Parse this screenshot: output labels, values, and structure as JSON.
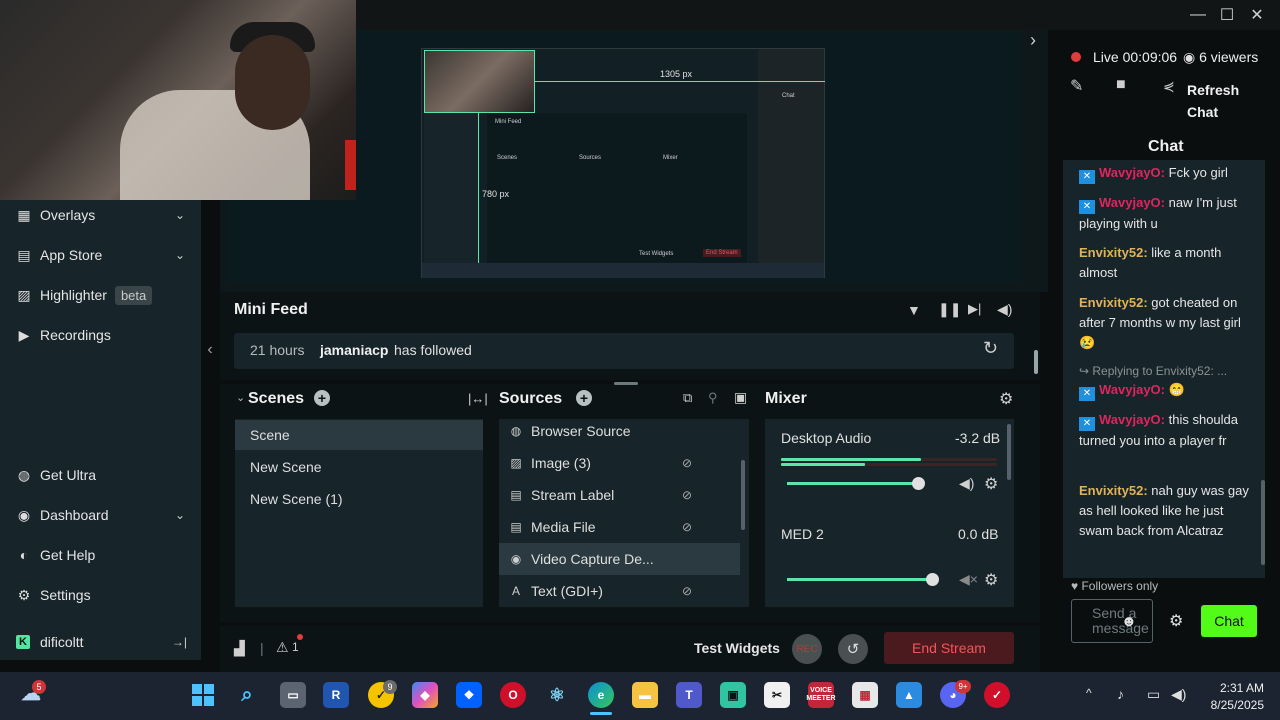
{
  "window": {
    "minimize": "—",
    "maximize": "☐",
    "close": "✕",
    "expand_arrow": "›"
  },
  "sidebar": {
    "items": [
      {
        "label": "Overlays",
        "icon": "overlays-icon",
        "chevron": "⌄"
      },
      {
        "label": "App Store",
        "icon": "store-icon",
        "chevron": "⌄"
      },
      {
        "label": "Highlighter",
        "badge": "beta",
        "icon": "highlighter-icon"
      },
      {
        "label": "Recordings",
        "icon": "play-icon"
      }
    ],
    "bottom": [
      {
        "label": "Get Ultra",
        "icon": "ultra-icon"
      },
      {
        "label": "Dashboard",
        "icon": "dashboard-icon",
        "chevron": "⌄"
      },
      {
        "label": "Get Help",
        "icon": "help-icon"
      },
      {
        "label": "Settings",
        "icon": "gear-icon"
      }
    ],
    "user": "dificoltt",
    "logout": "→|",
    "collapse": "‹"
  },
  "preview": {
    "width_label": "1305 px",
    "height_label": "780 px",
    "inner_feed_title": "Mini Feed",
    "inner_scenes": "Scenes",
    "inner_sources": "Sources",
    "inner_mixer": "Mixer",
    "inner_chat": "Chat",
    "inner_end": "End Stream",
    "inner_test": "Test Widgets"
  },
  "minifeed": {
    "title": "Mini Feed",
    "event": {
      "time": "21 hours",
      "user": "jamaniacp",
      "action": "has followed"
    }
  },
  "scenes": {
    "title": "Scenes",
    "add": "+",
    "items": [
      "Scene",
      "New Scene",
      "New Scene (1)"
    ],
    "selected": 0
  },
  "sources": {
    "title": "Sources",
    "add": "+",
    "items": [
      {
        "label": "Browser Source",
        "icon": "globe-icon",
        "hidden": false
      },
      {
        "label": "Image (3)",
        "icon": "image-icon",
        "hidden": true
      },
      {
        "label": "Stream Label",
        "icon": "file-icon",
        "hidden": true
      },
      {
        "label": "Media File",
        "icon": "file-icon",
        "hidden": true
      },
      {
        "label": "Video Capture De...",
        "icon": "webcam-icon",
        "hidden": false,
        "selected": true
      },
      {
        "label": "Text (GDI+)",
        "icon": "text-icon",
        "hidden": true
      }
    ]
  },
  "mixer": {
    "title": "Mixer",
    "channels": [
      {
        "name": "Desktop Audio",
        "db": "-3.2 dB",
        "level": 0.64,
        "muted": false
      },
      {
        "name": "MED 2",
        "db": "0.0 dB",
        "level": 0.7,
        "muted": true
      }
    ]
  },
  "footer": {
    "alerts": "1",
    "test_widgets": "Test Widgets",
    "rec": "REC",
    "end_stream": "End Stream"
  },
  "stream": {
    "live": "Live",
    "time": "00:09:06",
    "viewers": "6 viewers",
    "refresh": "Refresh",
    "refresh2": "Chat"
  },
  "chat": {
    "title": "Chat",
    "messages": [
      {
        "user": "WavyjayO",
        "text": "Fck yo girl",
        "style": "twitch"
      },
      {
        "user": "WavyjayO",
        "text": "naw I'm just playing with u",
        "style": "twitch"
      },
      {
        "user": "Envixity52",
        "text": "like a month almost",
        "style": "gold"
      },
      {
        "user": "Envixity52",
        "text": "got cheated on after 7 months w my last girl 😢",
        "style": "gold"
      },
      {
        "reply": "Replying to Envixity52: ..."
      },
      {
        "user": "WavyjayO",
        "text": "😁",
        "style": "twitch"
      },
      {
        "user": "WavyjayO",
        "text": "this shoulda turned you into a player fr",
        "style": "twitch"
      },
      {
        "user": "Envixity52",
        "text": "nah guy was gay as hell looked like he just swam back from Alcatraz",
        "style": "gold"
      }
    ],
    "followers_only": "Followers only",
    "placeholder": "Send a message",
    "send": "Chat"
  },
  "taskbar": {
    "time": "2:31 AM",
    "date": "8/25/2025",
    "weather_badge": "5",
    "discord_badge": "9+",
    "icons": [
      "windows-icon",
      "search-icon",
      "files-icon",
      "r-app-icon",
      "norton-icon",
      "copilot-icon",
      "dropbox-icon",
      "opera-icon",
      "atom-icon",
      "edge-icon",
      "folder-icon",
      "teams-icon",
      "streamlabs-icon",
      "capcut-icon",
      "voicemeeter-icon",
      "calc-icon",
      "photos-icon",
      "discord-icon",
      "antivirus-icon"
    ],
    "voicemeeter": "VOICE MEETER"
  }
}
